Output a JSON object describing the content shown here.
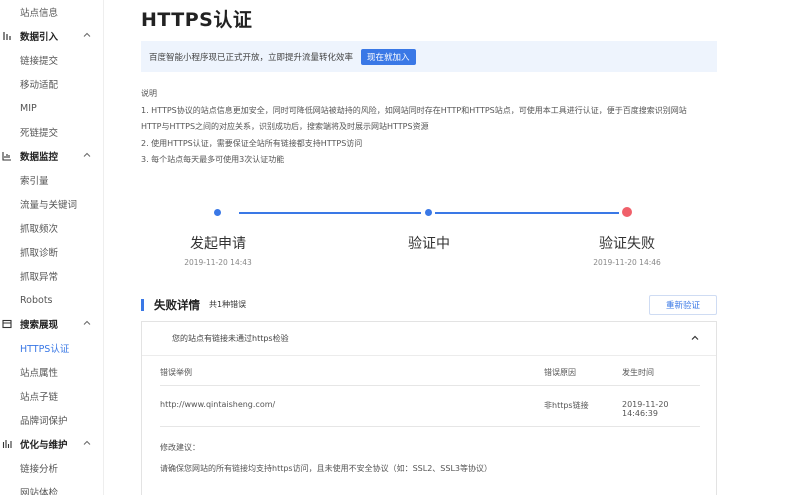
{
  "sidebar": {
    "items": [
      {
        "type": "item",
        "label": "站点信息"
      },
      {
        "type": "group",
        "label": "数据引入",
        "icon": "data-import-icon"
      },
      {
        "type": "item",
        "label": "链接提交"
      },
      {
        "type": "item",
        "label": "移动适配"
      },
      {
        "type": "item",
        "label": "MIP"
      },
      {
        "type": "item",
        "label": "死链提交"
      },
      {
        "type": "group",
        "label": "数据监控",
        "icon": "data-monitor-icon"
      },
      {
        "type": "item",
        "label": "索引量"
      },
      {
        "type": "item",
        "label": "流量与关键词"
      },
      {
        "type": "item",
        "label": "抓取频次"
      },
      {
        "type": "item",
        "label": "抓取诊断"
      },
      {
        "type": "item",
        "label": "抓取异常"
      },
      {
        "type": "item",
        "label": "Robots"
      },
      {
        "type": "group",
        "label": "搜索展现",
        "icon": "search-display-icon"
      },
      {
        "type": "item",
        "label": "HTTPS认证",
        "active": true
      },
      {
        "type": "item",
        "label": "站点属性"
      },
      {
        "type": "item",
        "label": "站点子链"
      },
      {
        "type": "item",
        "label": "品牌词保护"
      },
      {
        "type": "group",
        "label": "优化与维护",
        "icon": "optimize-icon"
      },
      {
        "type": "item",
        "label": "链接分析"
      },
      {
        "type": "item",
        "label": "网站体检"
      }
    ]
  },
  "page": {
    "title": "HTTPS认证"
  },
  "banner": {
    "text": "百度智能小程序现已正式开放，立即提升流量转化效率",
    "button": "现在就加入"
  },
  "description": {
    "heading": "说明",
    "lines": [
      "1. HTTPS协议的站点信息更加安全，同时可降低网站被劫持的风险，如网站同时存在HTTP和HTTPS站点，可使用本工具进行认证，便于百度搜索识别网站",
      "HTTP与HTTPS之间的对应关系，识别成功后，搜索端将及时展示网站HTTPS资源",
      "2. 使用HTTPS认证，需要保证全站所有链接都支持HTTPS访问",
      "3. 每个站点每天最多可使用3次认证功能"
    ]
  },
  "steps": [
    {
      "label": "发起申请",
      "time": "2019-11-20 14:43"
    },
    {
      "label": "验证中",
      "time": ""
    },
    {
      "label": "验证失败",
      "time": "2019-11-20 14:46"
    }
  ],
  "colors": {
    "accent": "#3a78e6",
    "fail": "#f0606a"
  },
  "failure": {
    "title": "失败详情",
    "count": "共1种错误",
    "retry_button": "重新验证",
    "reason_summary": "您的站点有链接未通过https检验",
    "columns": [
      "错误举例",
      "错误原因",
      "发生时间"
    ],
    "rows": [
      [
        "http://www.qintaisheng.com/",
        "非https链接",
        "2019-11-20 14:46:39"
      ]
    ],
    "suggestion_title": "修改建议：",
    "suggestion_text": "请确保您网站的所有链接均支持https访问，且未使用不安全协议（如：SSL2、SSL3等协议）"
  }
}
